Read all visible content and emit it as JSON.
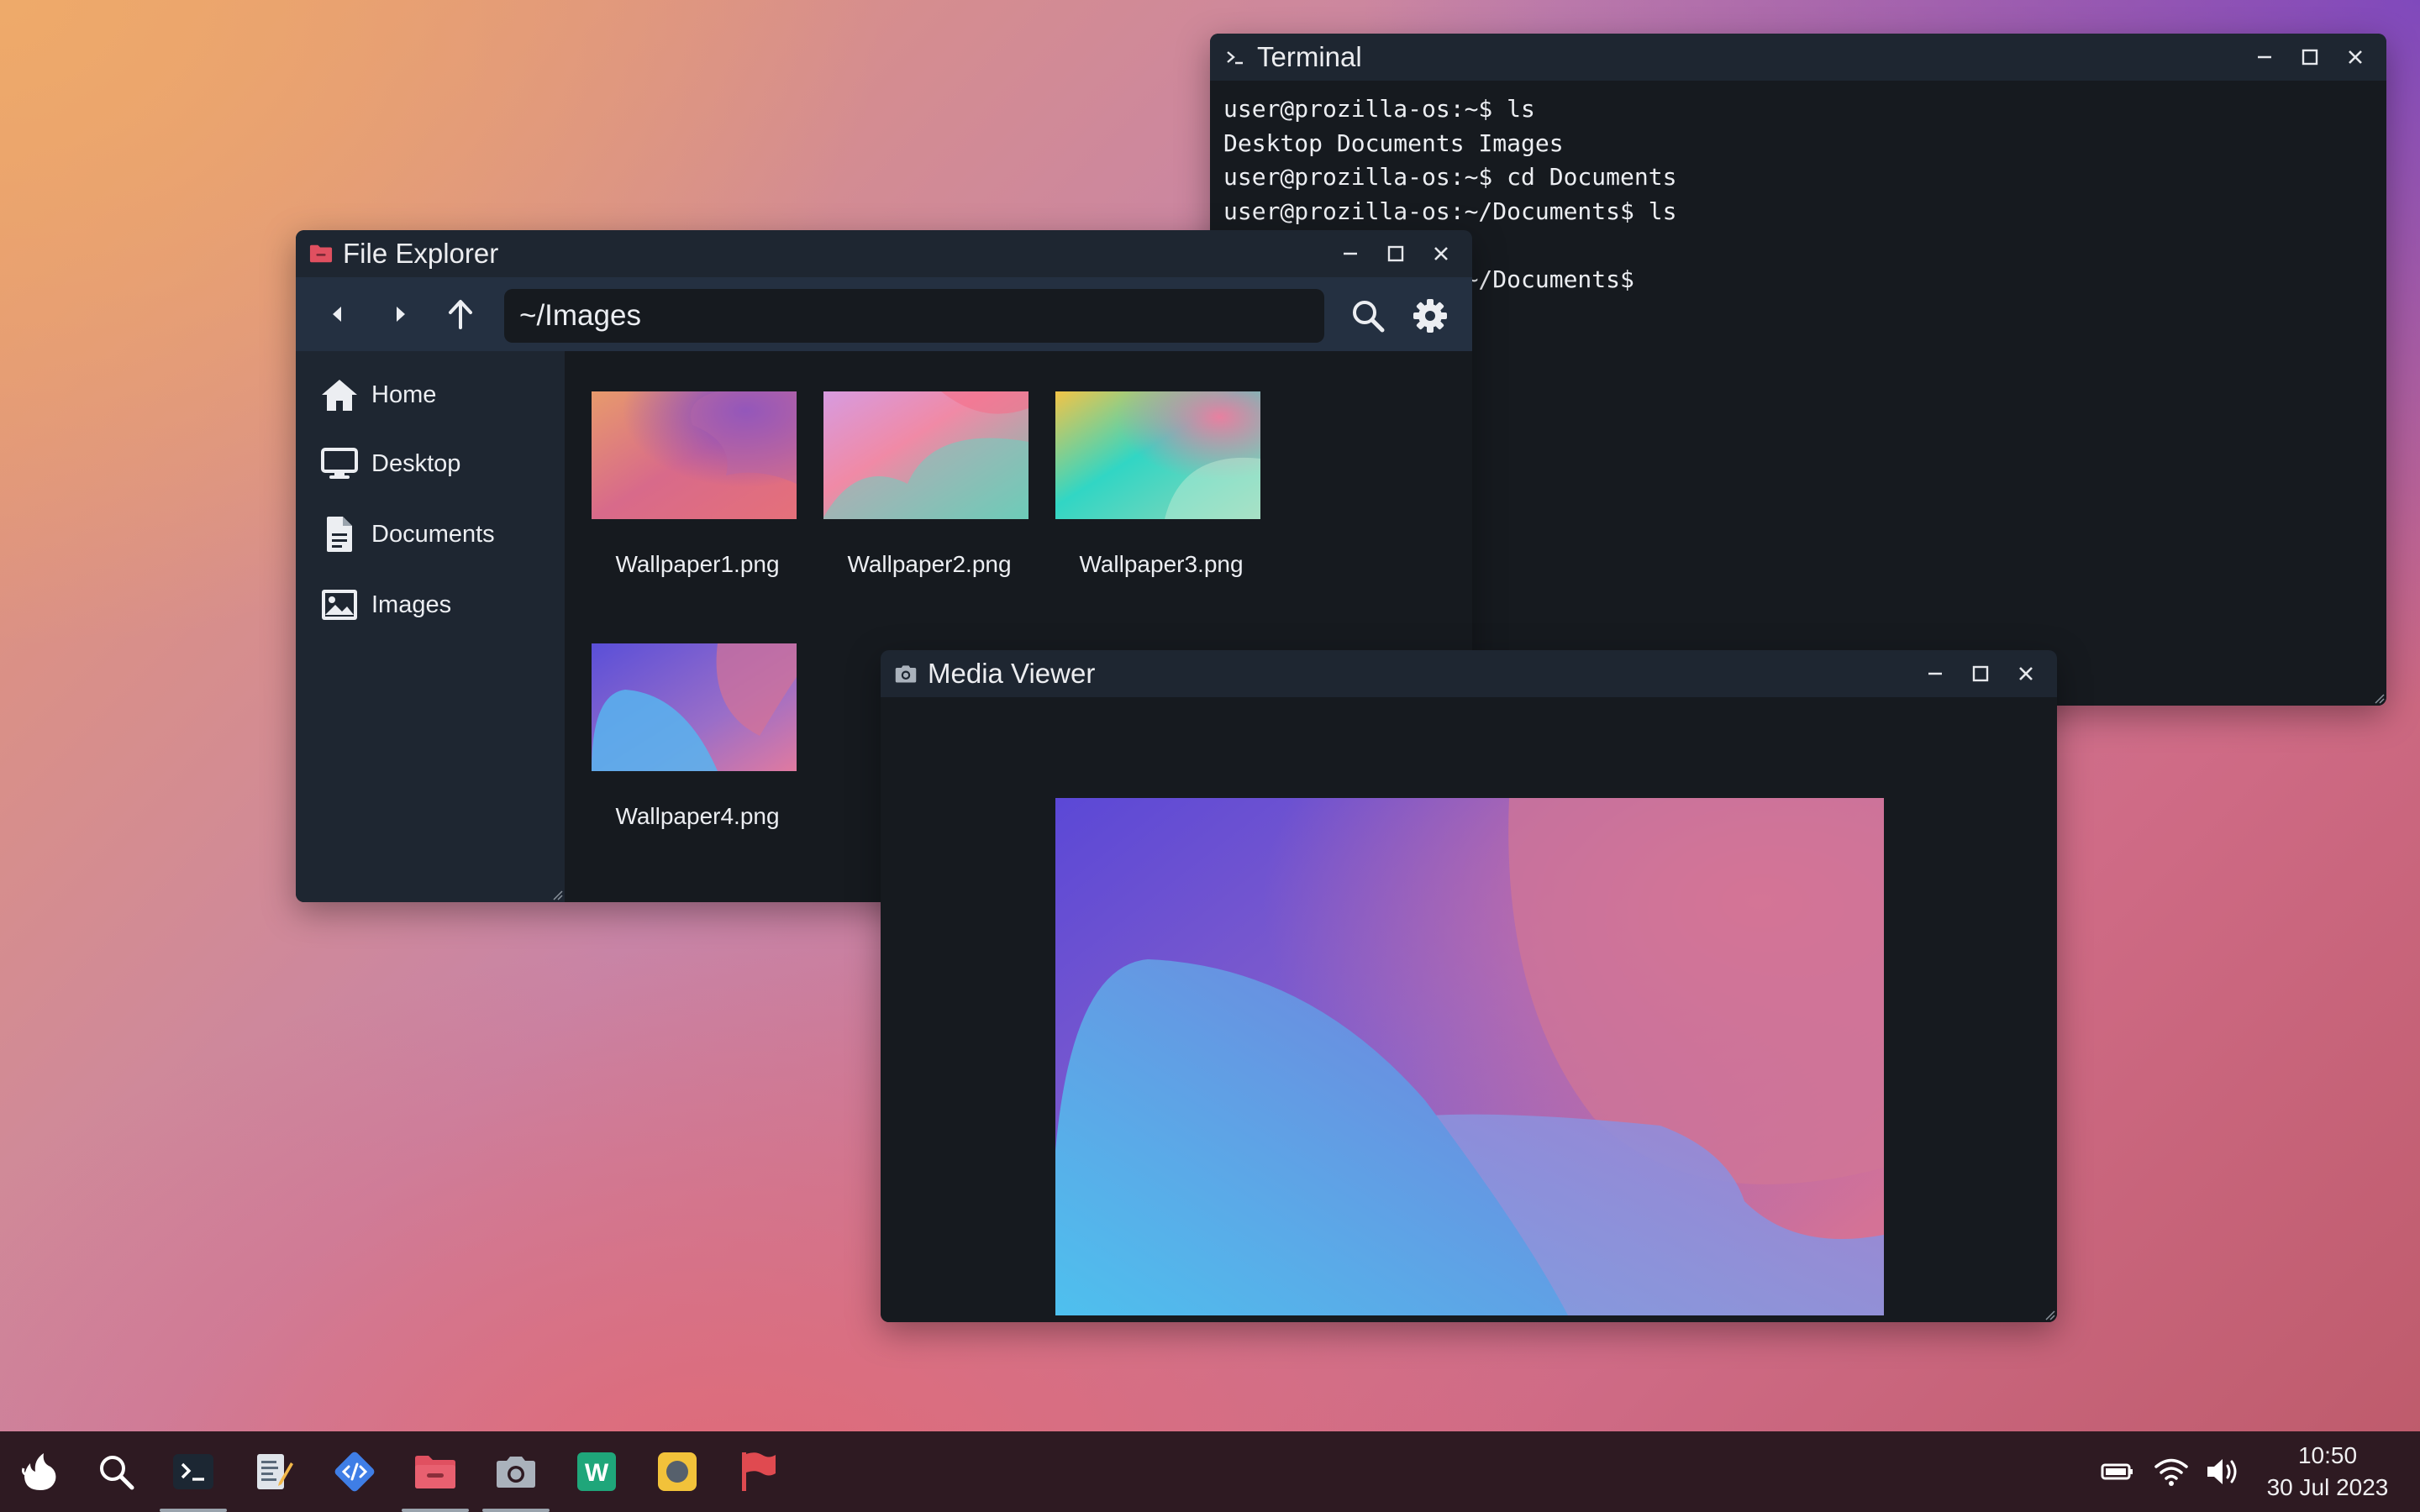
{
  "terminal": {
    "title": "Terminal",
    "lines": [
      "user@prozilla-os:~$ ls",
      "Desktop Documents Images",
      "user@prozilla-os:~$ cd Documents",
      "user@prozilla-os:~/Documents$ ls",
      "",
      "user@prozilla-os:~/Documents$"
    ],
    "icon": "terminal-prompt-icon"
  },
  "file_explorer": {
    "title": "File Explorer",
    "path": "~/Images",
    "icon": "folder-icon",
    "sidebar": [
      {
        "label": "Home",
        "icon": "home-icon"
      },
      {
        "label": "Desktop",
        "icon": "monitor-icon"
      },
      {
        "label": "Documents",
        "icon": "document-icon"
      },
      {
        "label": "Images",
        "icon": "image-icon"
      }
    ],
    "files": [
      {
        "name": "Wallpaper1.png"
      },
      {
        "name": "Wallpaper2.png"
      },
      {
        "name": "Wallpaper3.png"
      },
      {
        "name": "Wallpaper4.png"
      }
    ]
  },
  "media_viewer": {
    "title": "Media Viewer",
    "icon": "camera-icon"
  },
  "taskbar": {
    "apps": [
      {
        "name": "home-menu",
        "icon": "flame-logo-icon"
      },
      {
        "name": "search",
        "icon": "search-icon"
      },
      {
        "name": "terminal",
        "icon": "terminal-icon",
        "active": true
      },
      {
        "name": "text-editor",
        "icon": "text-editor-icon"
      },
      {
        "name": "code-editor",
        "icon": "code-icon"
      },
      {
        "name": "file-explorer",
        "icon": "folder-icon",
        "active": true
      },
      {
        "name": "media-viewer",
        "icon": "camera-icon",
        "active": true
      },
      {
        "name": "wordle",
        "icon": "wordle-icon"
      },
      {
        "name": "balls",
        "icon": "ball-icon"
      },
      {
        "name": "minesweeper",
        "icon": "flag-icon"
      }
    ],
    "tray": [
      "battery-icon",
      "wifi-icon",
      "volume-icon"
    ],
    "time": "10:50",
    "date": "30 Jul 2023"
  },
  "colors": {
    "window_bg": "#161a1f",
    "titlebar": "#1e2631",
    "toolbar": "#243041",
    "taskbar": "#2e1a22"
  }
}
